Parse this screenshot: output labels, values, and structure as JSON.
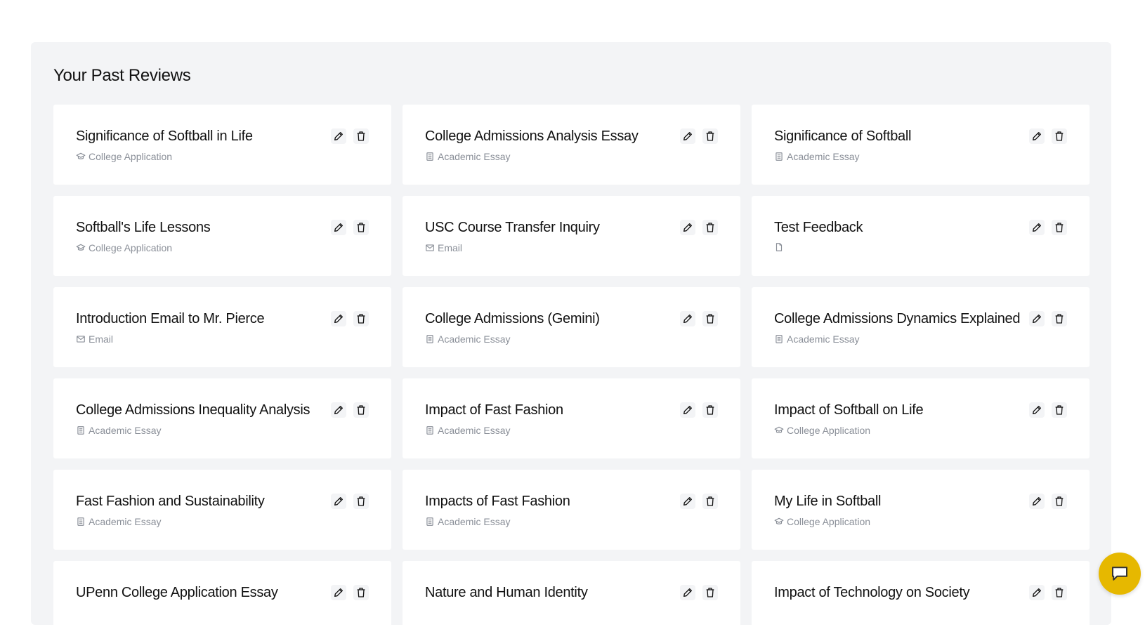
{
  "section": {
    "title": "Your Past Reviews"
  },
  "reviews": [
    {
      "title": "Significance of Softball in Life",
      "type": "College Application",
      "icon": "graduation-cap-icon"
    },
    {
      "title": "College Admissions Analysis Essay",
      "type": "Academic Essay",
      "icon": "document-icon"
    },
    {
      "title": "Significance of Softball",
      "type": "Academic Essay",
      "icon": "document-icon"
    },
    {
      "title": "Softball's Life Lessons",
      "type": "College Application",
      "icon": "graduation-cap-icon"
    },
    {
      "title": "USC Course Transfer Inquiry",
      "type": "Email",
      "icon": "mail-icon"
    },
    {
      "title": "Test Feedback",
      "type": "",
      "icon": "file-icon"
    },
    {
      "title": "Introduction Email to Mr. Pierce",
      "type": "Email",
      "icon": "mail-icon"
    },
    {
      "title": "College Admissions (Gemini)",
      "type": "Academic Essay",
      "icon": "document-icon"
    },
    {
      "title": "College Admissions Dynamics Explained",
      "type": "Academic Essay",
      "icon": "document-icon"
    },
    {
      "title": "College Admissions Inequality Analysis",
      "type": "Academic Essay",
      "icon": "document-icon"
    },
    {
      "title": "Impact of Fast Fashion",
      "type": "Academic Essay",
      "icon": "document-icon"
    },
    {
      "title": "Impact of Softball on Life",
      "type": "College Application",
      "icon": "graduation-cap-icon"
    },
    {
      "title": "Fast Fashion and Sustainability",
      "type": "Academic Essay",
      "icon": "document-icon"
    },
    {
      "title": "Impacts of Fast Fashion",
      "type": "Academic Essay",
      "icon": "document-icon"
    },
    {
      "title": "My Life in Softball",
      "type": "College Application",
      "icon": "graduation-cap-icon"
    },
    {
      "title": "UPenn College Application Essay",
      "type": "",
      "icon": ""
    },
    {
      "title": "Nature and Human Identity",
      "type": "",
      "icon": ""
    },
    {
      "title": "Impact of Technology on Society",
      "type": "",
      "icon": ""
    }
  ],
  "actions": {
    "edit_icon": "pencil-icon",
    "delete_icon": "trash-icon"
  },
  "chat": {
    "icon": "chat-icon",
    "color": "#e6b800"
  }
}
